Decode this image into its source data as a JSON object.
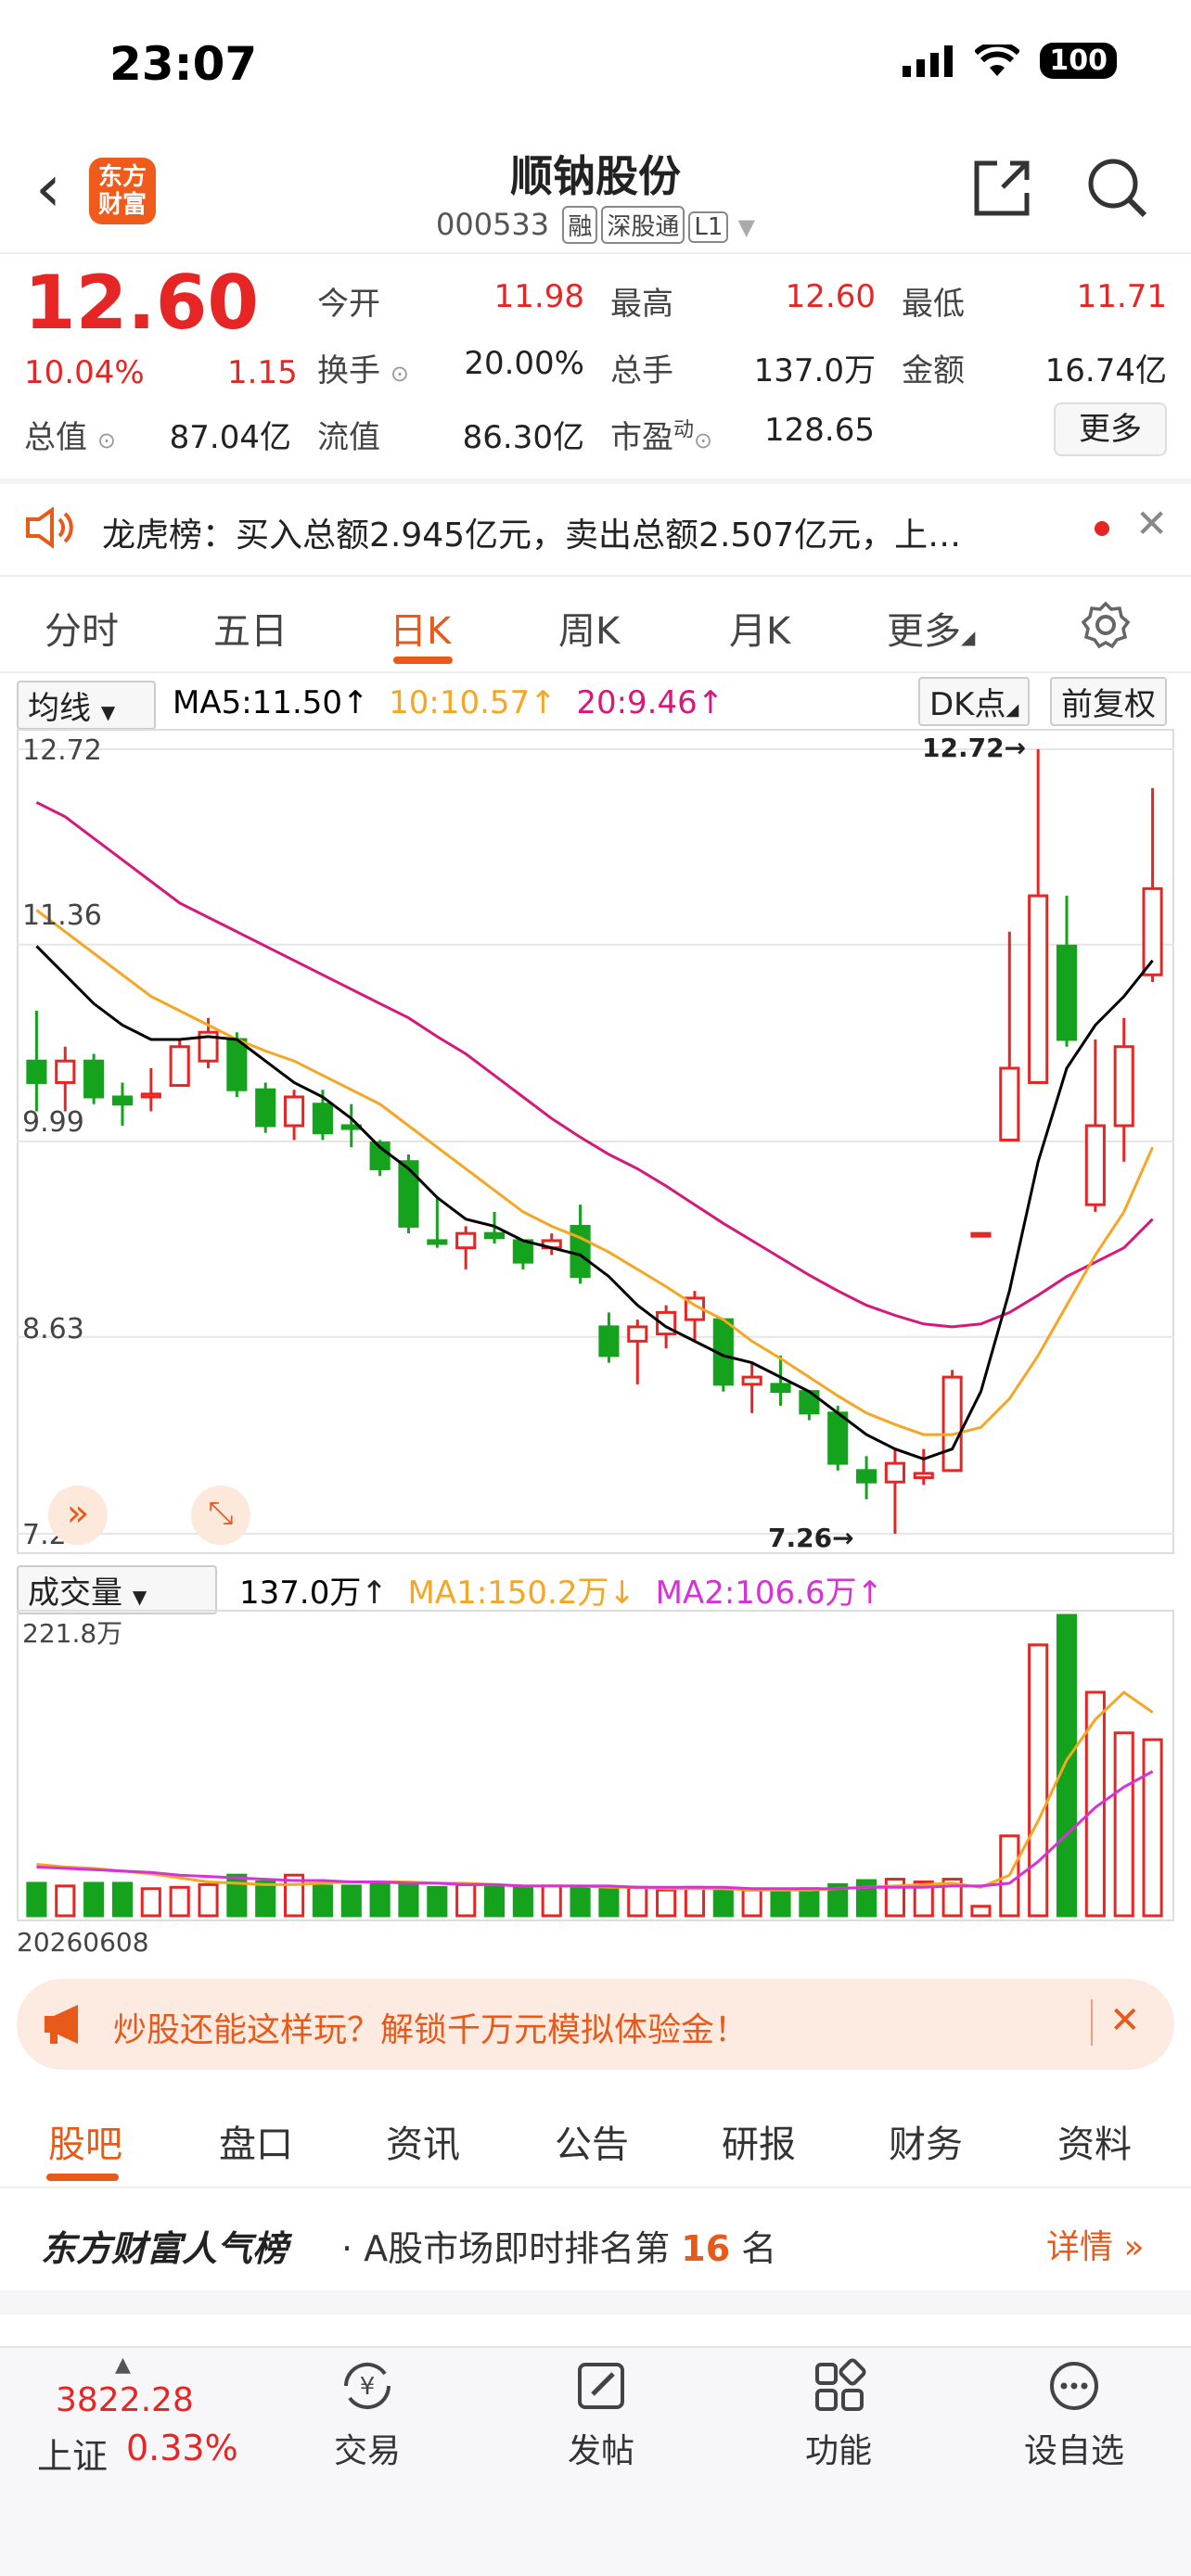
{
  "status_bar": {
    "time": "23:07",
    "battery": "100"
  },
  "header": {
    "logo": "东方\n财富",
    "title": "顺钠股份",
    "code": "000533",
    "tags": [
      "融",
      "深股通",
      "L1"
    ]
  },
  "quote": {
    "price": "12.60",
    "change_pct": "10.04%",
    "change": "1.15",
    "rows": [
      [
        {
          "label": "今开",
          "value": "11.98",
          "color": "red"
        },
        {
          "label": "最高",
          "value": "12.60",
          "color": "red"
        },
        {
          "label": "最低",
          "value": "11.71",
          "color": "red"
        }
      ],
      [
        {
          "label": "换手",
          "value": "20.00%",
          "color": "dark"
        },
        {
          "label": "总手",
          "value": "137.0万",
          "color": "dark"
        },
        {
          "label": "金额",
          "value": "16.74亿",
          "color": "dark"
        }
      ],
      [
        {
          "label": "总值",
          "value": "87.04亿",
          "color": "dark"
        },
        {
          "label": "流值",
          "value": "86.30亿",
          "color": "dark"
        },
        {
          "label": "市盈",
          "value": "128.65",
          "color": "dark"
        }
      ]
    ],
    "pe_sup": "动",
    "more_button": "更多"
  },
  "dragon_tiger": {
    "text": "龙虎榜：买入总额2.945亿元，卖出总额2.507亿元，上…"
  },
  "period_tabs": [
    "分时",
    "五日",
    "日K",
    "周K",
    "月K",
    "更多"
  ],
  "active_tab": "日K",
  "ma_bar": {
    "dropdown": "均线",
    "ma5": "MA5:11.50",
    "ma10": "10:10.57",
    "ma20": "20:9.46",
    "dk_button": "DK点",
    "adjust_button": "前复权",
    "arrow": "↑"
  },
  "volume_bar": {
    "dropdown": "成交量",
    "volume": "137.0万",
    "ma1": "MA1:150.2万",
    "ma2": "MA2:106.6万",
    "max_label": "221.8万",
    "date_label": "20260608"
  },
  "chart_data": {
    "type": "candlestick",
    "y_ticks": [
      "12.72",
      "11.36",
      "9.99",
      "8.63",
      "7.26"
    ],
    "ylim": [
      7.26,
      12.72
    ],
    "high_annotation": "12.72→",
    "low_annotation": "7.26→",
    "candles": [
      {
        "o": 10.55,
        "c": 10.4,
        "h": 10.9,
        "l": 10.2
      },
      {
        "o": 10.4,
        "c": 10.55,
        "h": 10.65,
        "l": 10.2
      },
      {
        "o": 10.55,
        "c": 10.3,
        "h": 10.6,
        "l": 10.25
      },
      {
        "o": 10.3,
        "c": 10.25,
        "h": 10.4,
        "l": 10.1
      },
      {
        "o": 10.3,
        "c": 10.32,
        "h": 10.5,
        "l": 10.2
      },
      {
        "o": 10.38,
        "c": 10.65,
        "h": 10.7,
        "l": 10.38
      },
      {
        "o": 10.55,
        "c": 10.75,
        "h": 10.85,
        "l": 10.5
      },
      {
        "o": 10.7,
        "c": 10.35,
        "h": 10.75,
        "l": 10.3
      },
      {
        "o": 10.35,
        "c": 10.1,
        "h": 10.4,
        "l": 10.05
      },
      {
        "o": 10.1,
        "c": 10.3,
        "h": 10.35,
        "l": 10.0
      },
      {
        "o": 10.25,
        "c": 10.05,
        "h": 10.35,
        "l": 10.0
      },
      {
        "o": 10.1,
        "c": 10.08,
        "h": 10.25,
        "l": 9.95
      },
      {
        "o": 9.98,
        "c": 9.8,
        "h": 10.0,
        "l": 9.75
      },
      {
        "o": 9.85,
        "c": 9.4,
        "h": 9.9,
        "l": 9.35
      },
      {
        "o": 9.3,
        "c": 9.28,
        "h": 9.6,
        "l": 9.25
      },
      {
        "o": 9.25,
        "c": 9.35,
        "h": 9.4,
        "l": 9.1
      },
      {
        "o": 9.35,
        "c": 9.32,
        "h": 9.5,
        "l": 9.28
      },
      {
        "o": 9.3,
        "c": 9.15,
        "h": 9.3,
        "l": 9.1
      },
      {
        "o": 9.25,
        "c": 9.3,
        "h": 9.35,
        "l": 9.2
      },
      {
        "o": 9.4,
        "c": 9.05,
        "h": 9.55,
        "l": 9.0
      },
      {
        "o": 8.7,
        "c": 8.5,
        "h": 8.8,
        "l": 8.45
      },
      {
        "o": 8.6,
        "c": 8.7,
        "h": 8.75,
        "l": 8.3
      },
      {
        "o": 8.65,
        "c": 8.8,
        "h": 8.85,
        "l": 8.55
      },
      {
        "o": 8.75,
        "c": 8.9,
        "h": 8.95,
        "l": 8.6
      },
      {
        "o": 8.75,
        "c": 8.3,
        "h": 8.75,
        "l": 8.25
      },
      {
        "o": 8.3,
        "c": 8.35,
        "h": 8.45,
        "l": 8.1
      },
      {
        "o": 8.3,
        "c": 8.25,
        "h": 8.5,
        "l": 8.15
      },
      {
        "o": 8.25,
        "c": 8.1,
        "h": 8.25,
        "l": 8.05
      },
      {
        "o": 8.1,
        "c": 7.75,
        "h": 8.15,
        "l": 7.7
      },
      {
        "o": 7.7,
        "c": 7.62,
        "h": 7.8,
        "l": 7.5
      },
      {
        "o": 7.62,
        "c": 7.75,
        "h": 7.85,
        "l": 7.26
      },
      {
        "o": 7.65,
        "c": 7.68,
        "h": 7.85,
        "l": 7.6
      },
      {
        "o": 7.7,
        "c": 8.35,
        "h": 8.4,
        "l": 7.7
      },
      {
        "o": 9.35,
        "c": 9.35,
        "h": 9.35,
        "l": 9.35
      },
      {
        "o": 10.0,
        "c": 10.5,
        "h": 11.45,
        "l": 10.0
      },
      {
        "o": 10.4,
        "c": 11.7,
        "h": 12.72,
        "l": 10.4
      },
      {
        "o": 11.35,
        "c": 10.7,
        "h": 11.7,
        "l": 10.65
      },
      {
        "o": 9.55,
        "c": 10.1,
        "h": 10.7,
        "l": 9.5
      },
      {
        "o": 10.1,
        "c": 10.65,
        "h": 10.85,
        "l": 9.85
      },
      {
        "o": 11.15,
        "c": 11.75,
        "h": 12.45,
        "l": 11.1
      }
    ],
    "ma5": [
      11.35,
      11.15,
      10.95,
      10.8,
      10.7,
      10.7,
      10.72,
      10.7,
      10.55,
      10.4,
      10.3,
      10.15,
      9.95,
      9.8,
      9.6,
      9.45,
      9.4,
      9.3,
      9.25,
      9.2,
      9.05,
      8.85,
      8.7,
      8.6,
      8.5,
      8.45,
      8.35,
      8.25,
      8.1,
      7.95,
      7.85,
      7.78,
      7.85,
      8.25,
      8.95,
      9.85,
      10.5,
      10.8,
      11.0,
      11.25
    ],
    "ma10": [
      11.6,
      11.45,
      11.3,
      11.15,
      11.0,
      10.9,
      10.8,
      10.7,
      10.62,
      10.55,
      10.45,
      10.35,
      10.25,
      10.1,
      9.95,
      9.8,
      9.65,
      9.5,
      9.4,
      9.32,
      9.22,
      9.1,
      8.98,
      8.85,
      8.75,
      8.6,
      8.48,
      8.35,
      8.22,
      8.1,
      8.02,
      7.95,
      7.95,
      8.0,
      8.2,
      8.5,
      8.85,
      9.2,
      9.5,
      9.95
    ],
    "ma20": [
      12.35,
      12.25,
      12.1,
      11.95,
      11.8,
      11.65,
      11.55,
      11.45,
      11.35,
      11.25,
      11.15,
      11.05,
      10.95,
      10.85,
      10.72,
      10.6,
      10.45,
      10.3,
      10.15,
      10.02,
      9.9,
      9.8,
      9.68,
      9.55,
      9.42,
      9.3,
      9.18,
      9.06,
      8.95,
      8.85,
      8.78,
      8.72,
      8.7,
      8.72,
      8.8,
      8.92,
      9.05,
      9.15,
      9.25,
      9.45
    ],
    "volume_ylim": [
      0,
      221.8
    ],
    "volumes": [
      24,
      22,
      24,
      24,
      20,
      21,
      23,
      30,
      25,
      30,
      22,
      22,
      23,
      23,
      21,
      23,
      21,
      21,
      22,
      20,
      20,
      21,
      19,
      21,
      19,
      19,
      19,
      20,
      23,
      26,
      27,
      25,
      27,
      7,
      59,
      200,
      221.8,
      165,
      135,
      130
    ],
    "vol_ma1": [
      38,
      36,
      35,
      33,
      31,
      28,
      25,
      24,
      23,
      23,
      24,
      25,
      25,
      25,
      24,
      24,
      23,
      22,
      22,
      22,
      21,
      21,
      20,
      20,
      20,
      19,
      19,
      19,
      20,
      21,
      22,
      23,
      24,
      21,
      30,
      70,
      115,
      145,
      165,
      150.2
    ],
    "vol_ma2": [
      36,
      35,
      34,
      33,
      32,
      30,
      29,
      28,
      27,
      26,
      26,
      25,
      25,
      24,
      24,
      23,
      23,
      22,
      22,
      22,
      22,
      21,
      21,
      21,
      21,
      20,
      20,
      20,
      20,
      21,
      21,
      21,
      22,
      22,
      24,
      40,
      60,
      80,
      95,
      106.6
    ],
    "colors": {
      "up": "#e62525",
      "down": "#15a31e",
      "ma5": "#000000",
      "ma10": "#f5a623",
      "ma20": "#d6187a"
    }
  },
  "promo": {
    "text": "炒股还能这样玩？解锁千万元模拟体验金！"
  },
  "bottom_tabs": [
    "股吧",
    "盘口",
    "资讯",
    "公告",
    "研报",
    "财务",
    "资料"
  ],
  "popularity": {
    "title": "东方财富人气榜",
    "prefix": "· A股市场即时排名第",
    "rank": "16",
    "suffix": "名",
    "detail": "详情 »"
  },
  "bottom_nav": {
    "index_value": "3822.28",
    "index_name": "上证",
    "index_pct": "0.33%",
    "items": [
      "交易",
      "发帖",
      "功能",
      "设自选"
    ]
  }
}
